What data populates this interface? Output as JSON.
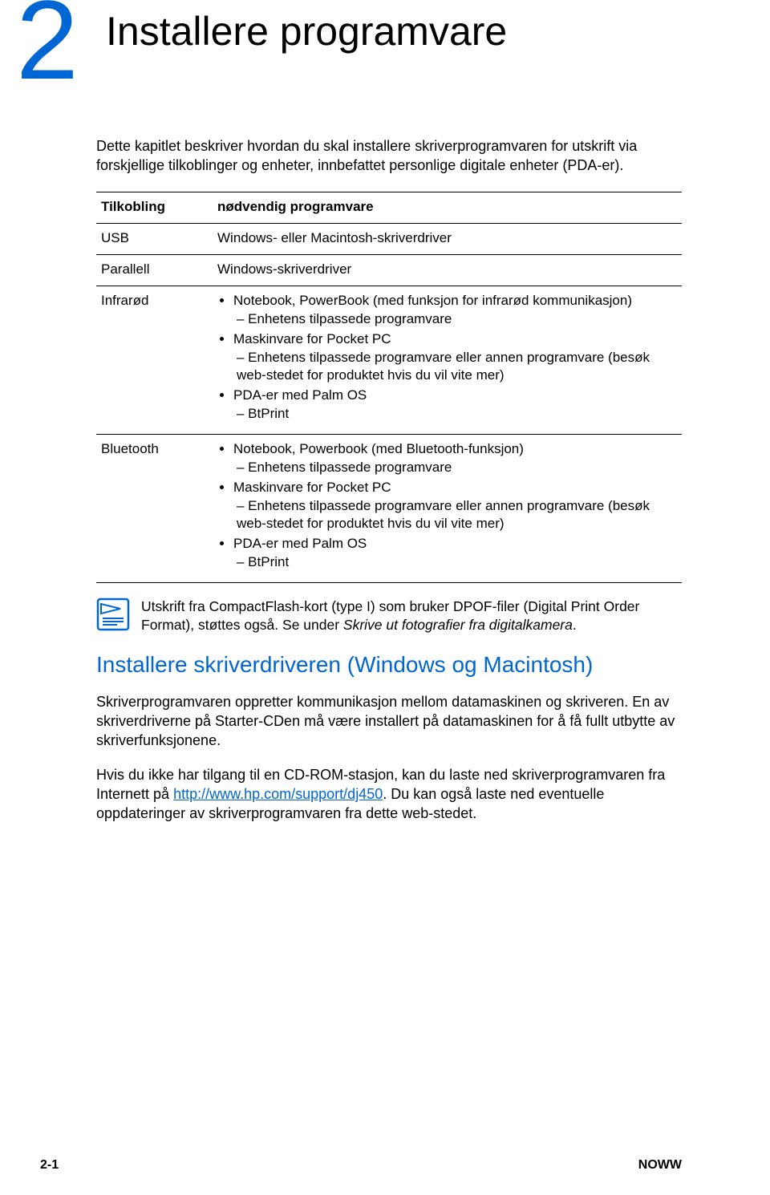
{
  "chapter": {
    "number": "2",
    "title": "Installere programvare"
  },
  "intro": "Dette kapitlet beskriver hvordan du skal installere skriverprogramvaren for utskrift via forskjellige tilkoblinger og enheter, innbefattet personlige digitale enheter (PDA-er).",
  "table": {
    "header": {
      "col1": "Tilkobling",
      "col2": "nødvendig programvare"
    },
    "rows": [
      {
        "col1": "USB",
        "col2_text": "Windows- eller Macintosh-skriverdriver"
      },
      {
        "col1": "Parallell",
        "col2_text": "Windows-skriverdriver"
      },
      {
        "col1": "Infrarød",
        "bullets": [
          {
            "main": "Notebook, PowerBook (med funksjon for infrarød kommunikasjon)",
            "sub": "– Enhetens tilpassede programvare"
          },
          {
            "main": "Maskinvare for Pocket PC",
            "sub": "– Enhetens tilpassede programvare eller annen programvare (besøk web-stedet for produktet hvis du vil vite mer)"
          },
          {
            "main": "PDA-er med Palm OS",
            "sub": "– BtPrint"
          }
        ]
      },
      {
        "col1": "Bluetooth",
        "bullets": [
          {
            "main": "Notebook, Powerbook (med Bluetooth-funksjon)",
            "sub": "– Enhetens tilpassede programvare"
          },
          {
            "main": "Maskinvare for Pocket PC",
            "sub": "– Enhetens tilpassede programvare eller annen programvare (besøk web-stedet for produktet hvis du vil vite mer)"
          },
          {
            "main": "PDA-er med Palm OS",
            "sub": "– BtPrint"
          }
        ]
      }
    ]
  },
  "note": {
    "part1": "Utskrift fra CompactFlash-kort (type I) som bruker DPOF-filer (Digital Print Order Format), støttes også. Se under ",
    "italic": "Skrive ut fotografier fra digitalkamera",
    "part2": "."
  },
  "section_heading": "Installere skriverdriveren (Windows og Macintosh)",
  "body": {
    "p1": "Skriverprogramvaren oppretter kommunikasjon mellom datamaskinen og skriveren. En av skriverdriverne på Starter-CDen må være installert på datamaskinen for å få fullt utbytte av skriverfunksjonene.",
    "p2_a": "Hvis du ikke har tilgang til en CD-ROM-stasjon, kan du laste ned skriverpro­gramvaren fra Internett på ",
    "link": "http://www.hp.com/support/dj450",
    "p2_b": ". Du kan også laste ned eventuelle oppdateringer av skriverprogramvaren fra dette web-stedet."
  },
  "footer": {
    "left": "2-1",
    "right": "NOWW"
  }
}
